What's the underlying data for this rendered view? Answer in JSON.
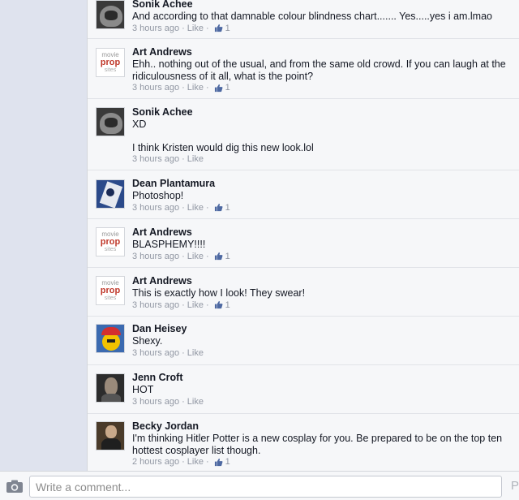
{
  "comments": [
    {
      "name": "Sonik Achee",
      "avatar": "sonik",
      "text": "And according to that damnable colour blindness chart....... Yes.....yes i am.lmao",
      "time": "3 hours ago",
      "like": "Like",
      "likes": "1"
    },
    {
      "name": "Art Andrews",
      "avatar": "art",
      "text": "Ehh.. nothing out of the usual, and from the same old crowd.  If you can laugh at the ridiculousness of it all, what is the point?",
      "time": "3 hours ago",
      "like": "Like",
      "likes": "1"
    },
    {
      "name": "Sonik Achee",
      "avatar": "sonik",
      "text": "XD",
      "text2": "I think Kristen would dig this new look.lol",
      "time": "3 hours ago",
      "like": "Like",
      "likes": ""
    },
    {
      "name": "Dean Plantamura",
      "avatar": "dean",
      "text": "Photoshop!",
      "time": "3 hours ago",
      "like": "Like",
      "likes": "1"
    },
    {
      "name": "Art Andrews",
      "avatar": "art",
      "text": "BLASPHEMY!!!!",
      "time": "3 hours ago",
      "like": "Like",
      "likes": "1"
    },
    {
      "name": "Art Andrews",
      "avatar": "art",
      "text": "This is exactly how I look!  They swear!",
      "time": "3 hours ago",
      "like": "Like",
      "likes": "1"
    },
    {
      "name": "Dan Heisey",
      "avatar": "dan",
      "text": "Shexy.",
      "time": "3 hours ago",
      "like": "Like",
      "likes": ""
    },
    {
      "name": "Jenn Croft",
      "avatar": "jenn",
      "text": "HOT",
      "time": "3 hours ago",
      "like": "Like",
      "likes": ""
    },
    {
      "name": "Becky Jordan",
      "avatar": "becky",
      "text": "I'm thinking Hitler Potter is a new cosplay for you. Be prepared to be on the top ten hottest cosplayer  list though.",
      "time": "2 hours ago",
      "like": "Like",
      "likes": "1"
    }
  ],
  "art_logo": {
    "line1": "movie",
    "line2": "prop",
    "line3": "sites"
  },
  "composer": {
    "placeholder": "Write a comment...",
    "post_label": "Post",
    "camera_icon": "camera-icon"
  },
  "colors": {
    "like_blue": "#4e69a2",
    "name": "#141823",
    "meta": "#9197a3"
  }
}
